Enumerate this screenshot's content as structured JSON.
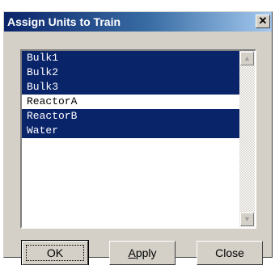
{
  "window": {
    "title": "Assign Units to Train",
    "close_glyph": "✕"
  },
  "units_list": {
    "items": [
      {
        "label": "Bulk1",
        "selected": true
      },
      {
        "label": "Bulk2",
        "selected": true
      },
      {
        "label": "Bulk3",
        "selected": true
      },
      {
        "label": "ReactorA",
        "selected": false
      },
      {
        "label": "ReactorB",
        "selected": true
      },
      {
        "label": "Water",
        "selected": true
      }
    ],
    "selection_color": "#0a246a"
  },
  "buttons": {
    "ok_label": "OK",
    "apply_label": "Apply",
    "close_label": "Close"
  },
  "icons": {
    "scroll_up": "scroll-up-arrow-icon",
    "scroll_down": "scroll-down-arrow-icon"
  }
}
